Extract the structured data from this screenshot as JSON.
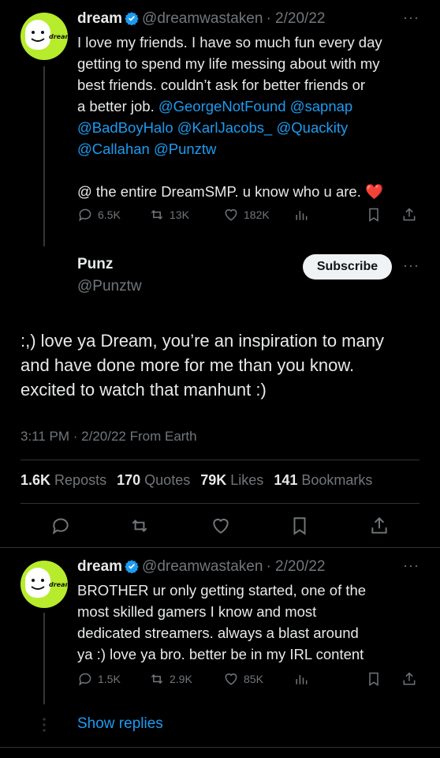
{
  "tweet1": {
    "name": "dream",
    "handle": "@dreamwastaken",
    "date": "· 2/20/22",
    "avatar_text": "dream",
    "line1": "I love my friends. I have so much fun every day",
    "line2": "getting to spend my life messing about with my",
    "line3": "best friends. couldn’t ask for better friends or",
    "line4_pre": "a better job. ",
    "m1": "@GeorgeNotFound",
    "m2": "@sapnap",
    "m3": "@BadBoyHalo",
    "m4": "@KarlJacobs_",
    "m5": "@Quackity",
    "m6": "@Callahan",
    "m7": "@Punztw",
    "line7": "@ the entire DreamSMP. u know who u are.",
    "heart_emoji": "❤️",
    "replies": "6.5K",
    "reposts": "13K",
    "likes": "182K"
  },
  "main": {
    "name": "Punz",
    "handle": "@Punztw",
    "subscribe": "Subscribe",
    "text1": ":,) love ya Dream, you’re an inspiration to many",
    "text2": "and have done more for me than you know.",
    "text3": "excited to watch that manhunt :)",
    "meta": "3:11 PM · 2/20/22 From Earth",
    "reposts_count": "1.6K",
    "reposts_label": "Reposts",
    "quotes_count": "170",
    "quotes_label": "Quotes",
    "likes_count": "79K",
    "likes_label": "Likes",
    "bookmarks_count": "141",
    "bookmarks_label": "Bookmarks"
  },
  "reply": {
    "name": "dream",
    "handle": "@dreamwastaken",
    "date": "· 2/20/22",
    "avatar_text": "dream",
    "line1": "BROTHER ur only getting started, one of the",
    "line2": "most skilled gamers I know and most",
    "line3": "dedicated streamers. always a blast around",
    "line4": "ya :) love ya bro. better be in my IRL content",
    "replies": "1.5K",
    "reposts": "2.9K",
    "likes": "85K",
    "show_replies": "Show replies"
  },
  "colors": {
    "accent": "#1d9bf0",
    "muted": "#71767b",
    "avatar": "#b7ec2c"
  }
}
